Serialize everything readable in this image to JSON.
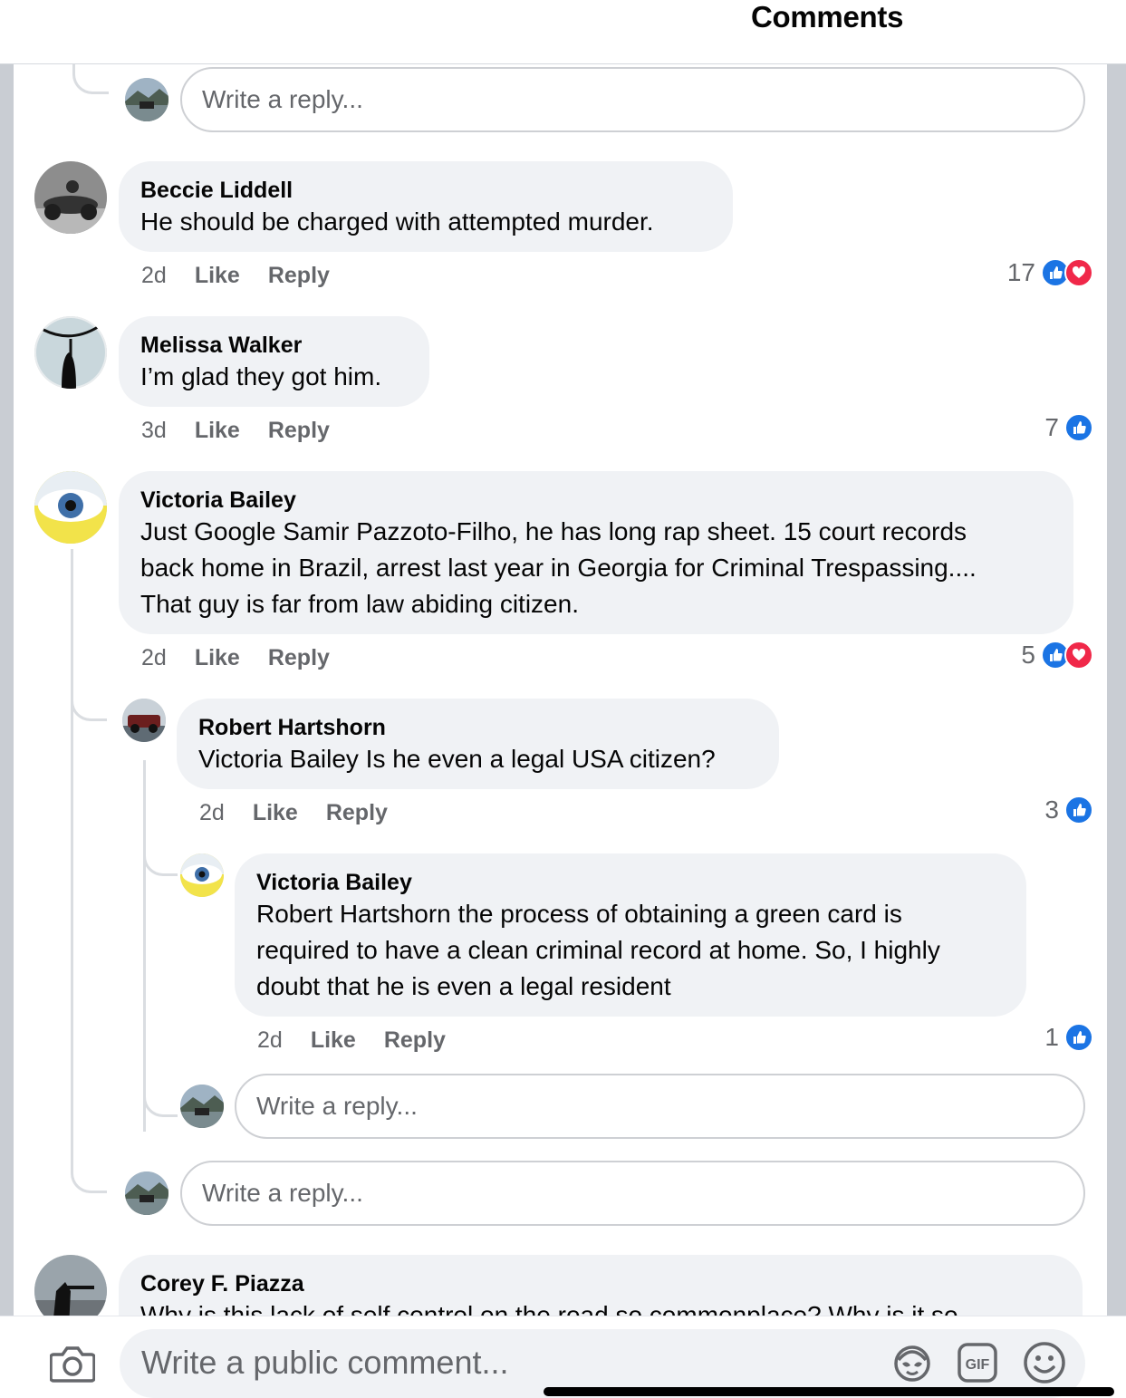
{
  "header": {
    "title": "Comments"
  },
  "reply_placeholder": "Write a reply...",
  "comments": [
    {
      "name": "Beccie Liddell",
      "text": "He should be charged with attempted murder.",
      "time": "2d",
      "like": "Like",
      "reply": "Reply",
      "reaction_count": "17",
      "reactions": [
        "like-icon",
        "love-icon"
      ]
    },
    {
      "name": "Melissa Walker",
      "text": "I’m glad they got him.",
      "time": "3d",
      "like": "Like",
      "reply": "Reply",
      "reaction_count": "7",
      "reactions": [
        "like-icon"
      ]
    },
    {
      "name": "Victoria Bailey",
      "text_lines": [
        "Just Google Samir Pazzoto-Filho, he has long rap sheet. 15 court records",
        "back home in Brazil, arrest last year in Georgia for Criminal Trespassing....",
        "That guy is far from law abiding citizen."
      ],
      "time": "2d",
      "like": "Like",
      "reply": "Reply",
      "reaction_count": "5",
      "reactions": [
        "like-icon",
        "love-icon"
      ],
      "replies": [
        {
          "name": "Robert Hartshorn",
          "text": "Victoria Bailey Is he even a legal USA citizen?",
          "time": "2d",
          "like": "Like",
          "reply": "Reply",
          "reaction_count": "3",
          "reactions": [
            "like-icon"
          ],
          "replies": [
            {
              "name": "Victoria Bailey",
              "text_lines": [
                "Robert Hartshorn the process of obtaining a green card is",
                "required to have a clean criminal record at home. So, I highly",
                "doubt that he is even a legal resident"
              ],
              "time": "2d",
              "like": "Like",
              "reply": "Reply",
              "reaction_count": "1",
              "reactions": [
                "like-icon"
              ]
            }
          ]
        }
      ]
    },
    {
      "name": "Corey F. Piazza",
      "text": "Why is this lack of self control on the road so commonplace? Why is it so"
    }
  ],
  "composer": {
    "placeholder": "Write a public comment...",
    "icons": [
      "camera-icon",
      "avatar-sticker-icon",
      "gif-icon",
      "emoji-icon"
    ]
  },
  "colors": {
    "like": "#1b74e4",
    "love": "#f02849",
    "bubble": "#f0f2f5",
    "meta": "#65676b"
  }
}
